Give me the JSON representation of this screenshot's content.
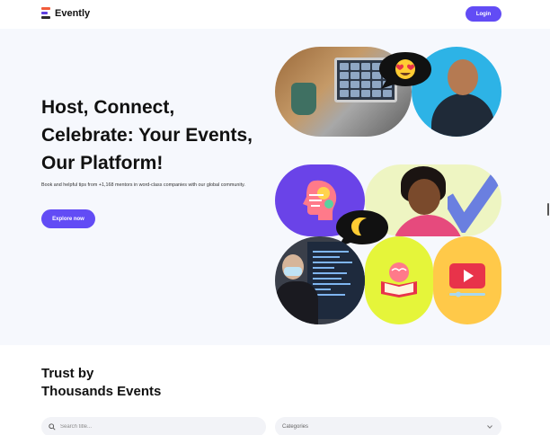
{
  "header": {
    "brand": "Evently",
    "login_label": "Login"
  },
  "hero": {
    "title_lines": [
      "Host, Connect,",
      "Celebrate: Your Events,",
      "Our Platform!"
    ],
    "description": "Book and helpful tips from +1,168 mentors in word-class companies with our global community.",
    "cta_label": "Explore now"
  },
  "collage": {
    "bubble_top_icon": "heart-eyes-emoji-icon",
    "bubble_bottom_icon": "crescent-moon-icon",
    "tiles": [
      "laptop-video-call",
      "smiling-man",
      "brain-idea",
      "happy-woman",
      "teacher-whiteboard",
      "brain-book",
      "video-play"
    ]
  },
  "trust": {
    "title_line1": "Trust by",
    "title_line2": "Thousands Events"
  },
  "filters": {
    "search_placeholder": "Search title...",
    "category_label": "Categories"
  },
  "colors": {
    "accent": "#624cf5",
    "hero_bg": "#f6f8fd"
  }
}
